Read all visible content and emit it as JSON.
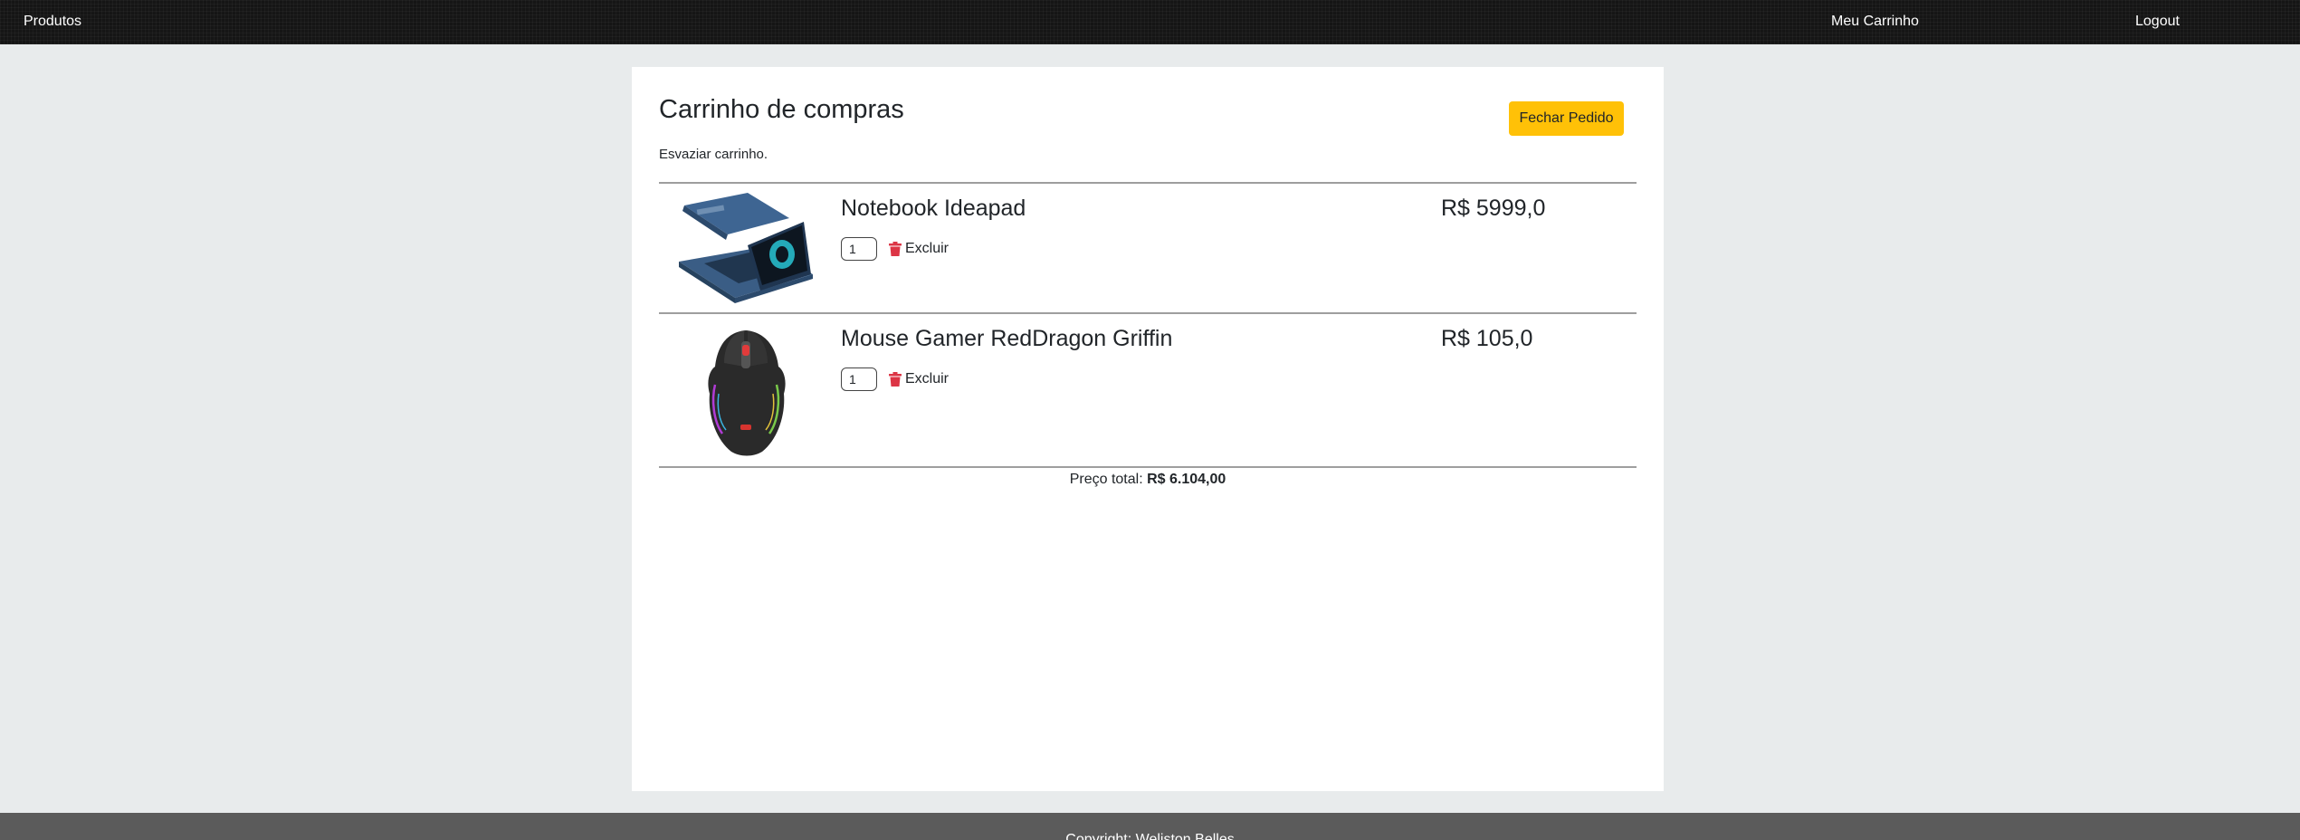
{
  "nav": {
    "products_label": "Produtos",
    "cart_label": "Meu Carrinho",
    "logout_label": "Logout"
  },
  "cart": {
    "title": "Carrinho de compras",
    "checkout_label": "Fechar Pedido",
    "empty_label": "Esvaziar carrinho.",
    "remove_icon": "trash-icon",
    "accent_color": "#ffc107",
    "items": [
      {
        "name": "Notebook Ideapad",
        "price": "R$ 5999,0",
        "quantity": "1",
        "remove_label": "Excluir"
      },
      {
        "name": "Mouse Gamer RedDragon Griffin",
        "price": "R$ 105,0",
        "quantity": "1",
        "remove_label": "Excluir"
      }
    ],
    "total_label": "Preço total:",
    "total_value": "R$ 6.104,00"
  },
  "footer": {
    "text": "Copyright: Weliston Belles"
  }
}
